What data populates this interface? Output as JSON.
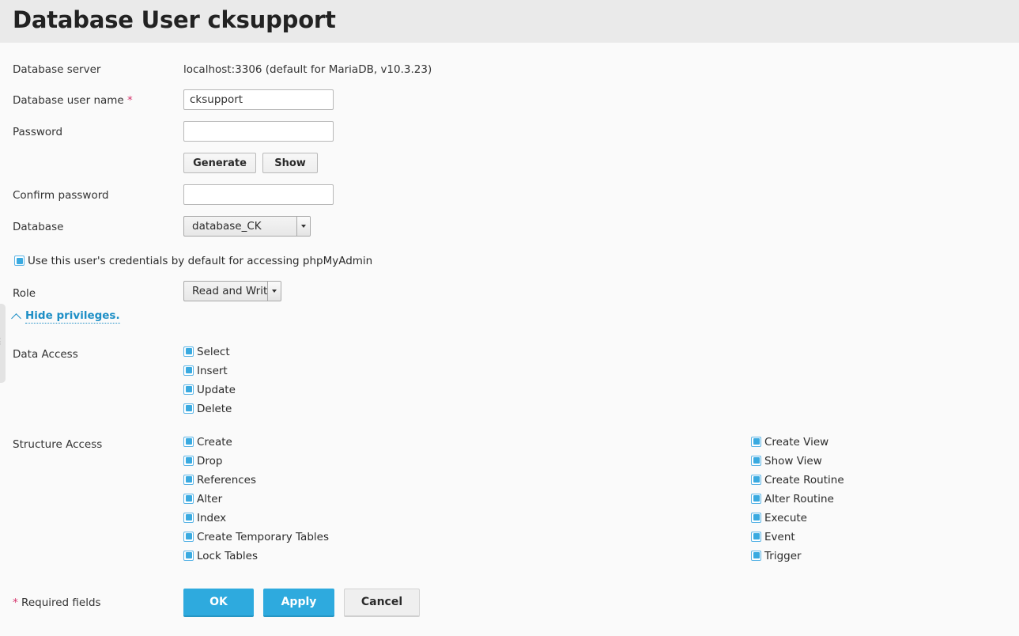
{
  "header": {
    "title": "Database User cksupport"
  },
  "form": {
    "server": {
      "label": "Database server",
      "value": "localhost:3306 (default for MariaDB, v10.3.23)"
    },
    "username": {
      "label": "Database user name",
      "required_marker": "*",
      "value": "cksupport",
      "placeholder": ""
    },
    "password": {
      "label": "Password",
      "value": "",
      "placeholder": "",
      "generate_label": "Generate",
      "show_label": "Show"
    },
    "confirm_password": {
      "label": "Confirm password",
      "value": "",
      "placeholder": ""
    },
    "database": {
      "label": "Database",
      "selected": "database_CK"
    },
    "default_credentials": {
      "label": "Use this user's credentials by default for accessing phpMyAdmin",
      "checked": true
    },
    "role": {
      "label": "Role",
      "selected": "Read and Write"
    },
    "privileges_toggle": {
      "label": "Hide privileges.",
      "icon": "chevron-up-icon"
    }
  },
  "privileges": {
    "data_access": {
      "label": "Data Access",
      "items": [
        {
          "label": "Select",
          "checked": true
        },
        {
          "label": "Insert",
          "checked": true
        },
        {
          "label": "Update",
          "checked": true
        },
        {
          "label": "Delete",
          "checked": true
        }
      ]
    },
    "structure_access": {
      "label": "Structure Access",
      "left_items": [
        {
          "label": "Create",
          "checked": true
        },
        {
          "label": "Drop",
          "checked": true
        },
        {
          "label": "References",
          "checked": true
        },
        {
          "label": "Alter",
          "checked": true
        },
        {
          "label": "Index",
          "checked": true
        },
        {
          "label": "Create Temporary Tables",
          "checked": true
        },
        {
          "label": "Lock Tables",
          "checked": true
        }
      ],
      "right_items": [
        {
          "label": "Create View",
          "checked": true
        },
        {
          "label": "Show View",
          "checked": true
        },
        {
          "label": "Create Routine",
          "checked": true
        },
        {
          "label": "Alter Routine",
          "checked": true
        },
        {
          "label": "Execute",
          "checked": true
        },
        {
          "label": "Event",
          "checked": true
        },
        {
          "label": "Trigger",
          "checked": true
        }
      ]
    }
  },
  "footer": {
    "required_note_marker": "*",
    "required_note": "Required fields",
    "ok_label": "OK",
    "apply_label": "Apply",
    "cancel_label": "Cancel"
  },
  "colors": {
    "accent": "#2eaade",
    "link": "#1e8fc6",
    "required": "#d6336c",
    "header_bg": "#eaeaea",
    "body_bg": "#fafafa"
  }
}
